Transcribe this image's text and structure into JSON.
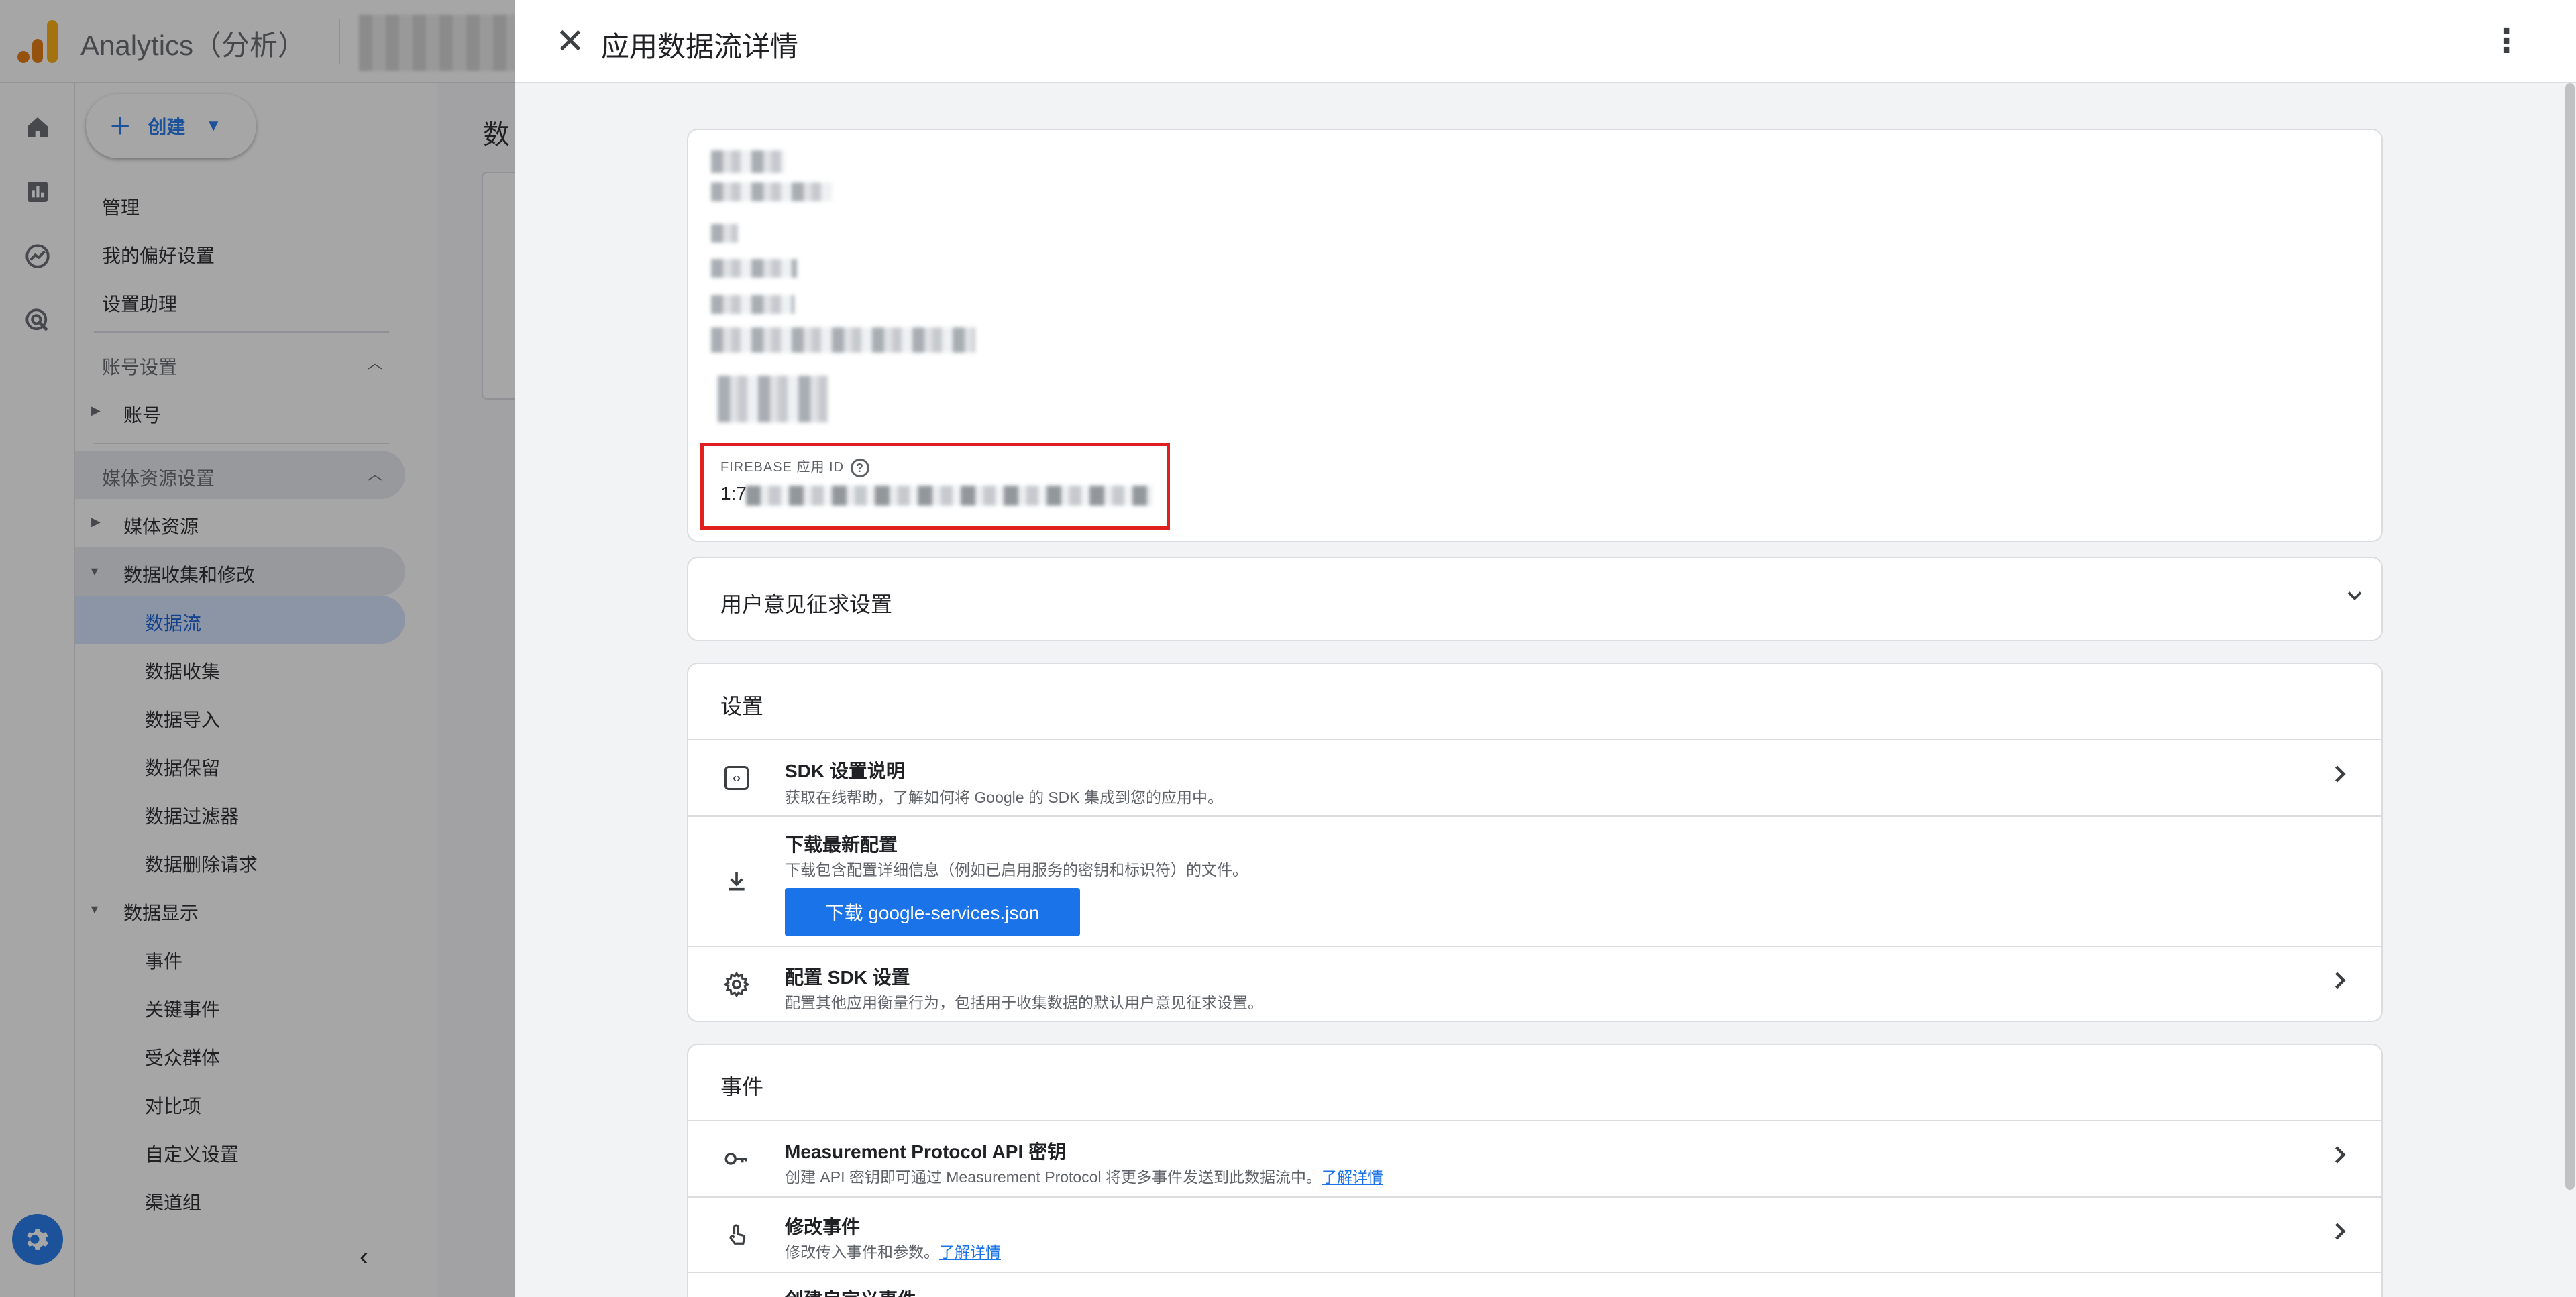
{
  "app": {
    "product_name": "Analytics（分析）",
    "create_label": "创建",
    "breadcrumb_partial": "数",
    "nav": {
      "admin": "管理",
      "preferences": "我的偏好设置",
      "setup_assistant": "设置助理",
      "account_settings": "账号设置",
      "account": "账号",
      "property_settings": "媒体资源设置",
      "property": "媒体资源",
      "data_collection_modification": "数据收集和修改",
      "data_streams": "数据流",
      "data_collection": "数据收集",
      "data_import": "数据导入",
      "data_retention": "数据保留",
      "data_filters": "数据过滤器",
      "data_deletion_requests": "数据删除请求",
      "data_display": "数据显示",
      "events": "事件",
      "key_events": "关键事件",
      "audiences": "受众群体",
      "comparisons": "对比项",
      "custom_definitions": "自定义设置",
      "channel_groups": "渠道组"
    },
    "icons": {
      "home": "home-icon",
      "reports": "bar-chart-icon",
      "explore": "explore-icon",
      "advertising": "target-icon",
      "admin": "gear-icon"
    },
    "accent_color": "#1a73e8"
  },
  "drawer": {
    "title": "应用数据流详情",
    "firebase_label": "FIREBASE 应用 ID",
    "firebase_value_prefix": "1:7",
    "consent_title": "用户意见征求设置",
    "settings_section": {
      "title": "设置",
      "sdk_title": "SDK 设置说明",
      "sdk_desc": "获取在线帮助，了解如何将 Google 的 SDK 集成到您的应用中。",
      "download_title": "下载最新配置",
      "download_desc": "下载包含配置详细信息（例如已启用服务的密钥和标识符）的文件。",
      "download_button": "下载 google-services.json",
      "configure_title": "配置 SDK 设置",
      "configure_desc": "配置其他应用衡量行为，包括用于收集数据的默认用户意见征求设置。"
    },
    "events_section": {
      "title": "事件",
      "mp_title": "Measurement Protocol API 密钥",
      "mp_desc": "创建 API 密钥即可通过 Measurement Protocol 将更多事件发送到此数据流中。",
      "mp_link": "了解详情",
      "modify_title": "修改事件",
      "modify_desc": "修改传入事件和参数。",
      "modify_link": "了解详情",
      "create_title": "创建自定义事件"
    }
  }
}
